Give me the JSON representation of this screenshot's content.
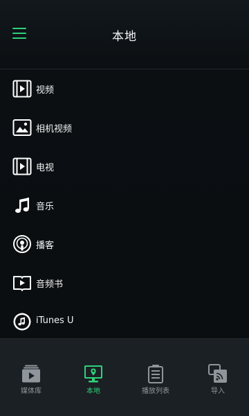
{
  "header": {
    "title": "本地"
  },
  "list": {
    "items": [
      {
        "label": "视频",
        "icon": "video-icon"
      },
      {
        "label": "相机视频",
        "icon": "camera-photo-icon"
      },
      {
        "label": "电视",
        "icon": "tv-icon"
      },
      {
        "label": "音乐",
        "icon": "music-note-icon"
      },
      {
        "label": "播客",
        "icon": "podcast-icon"
      },
      {
        "label": "音频书",
        "icon": "audiobook-icon"
      },
      {
        "label": "iTunes U",
        "icon": "itunes-u-icon"
      }
    ]
  },
  "tabbar": {
    "tabs": [
      {
        "label": "媒体库",
        "icon": "library-icon",
        "active": false
      },
      {
        "label": "本地",
        "icon": "local-device-icon",
        "active": true
      },
      {
        "label": "播放列表",
        "icon": "playlist-icon",
        "active": false
      },
      {
        "label": "导入",
        "icon": "import-icon",
        "active": false
      }
    ]
  },
  "colors": {
    "accent": "#2fd17a",
    "background": "#0c1013",
    "tabbar": "#1b2024"
  }
}
